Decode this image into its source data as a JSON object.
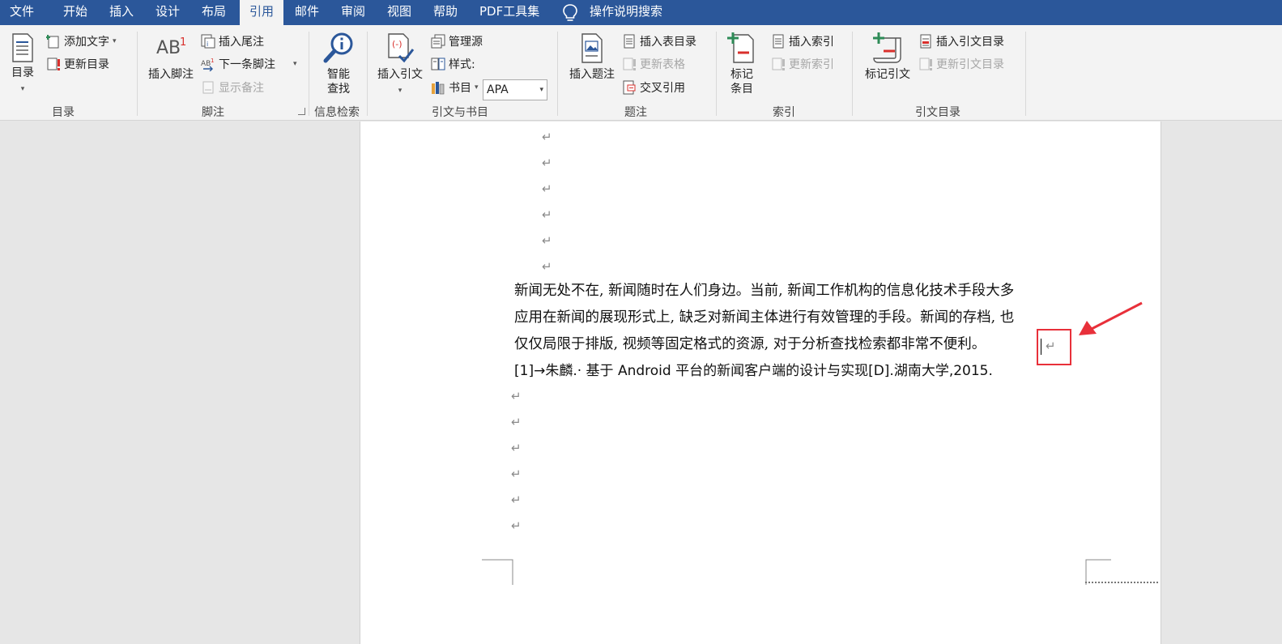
{
  "tabs": [
    "文件",
    "开始",
    "插入",
    "设计",
    "布局",
    "引用",
    "邮件",
    "审阅",
    "视图",
    "帮助",
    "PDF工具集"
  ],
  "active_tab": "引用",
  "search": {
    "label": "操作说明搜索"
  },
  "ribbon": {
    "toc": {
      "group": "目录",
      "big": "目录",
      "add_text": "添加文字",
      "update": "更新目录"
    },
    "footnotes": {
      "group": "脚注",
      "insert_footnote": "插入脚注",
      "insert_endnote": "插入尾注",
      "next_footnote": "下一条脚注",
      "show_notes": "显示备注",
      "ab_glyph": "AB",
      "sup": "1"
    },
    "research": {
      "group": "信息检索",
      "smart_lookup_line1": "智能",
      "smart_lookup_line2": "查找"
    },
    "citations": {
      "group": "引文与书目",
      "insert_citation": "插入引文",
      "manage_sources": "管理源",
      "style_label": "样式:",
      "style_value": "APA",
      "bibliography": "书目"
    },
    "captions": {
      "group": "题注",
      "insert_caption": "插入题注",
      "insert_table_of_figures": "插入表目录",
      "update_table": "更新表格",
      "cross_reference": "交叉引用"
    },
    "index": {
      "group": "索引",
      "mark_entry_line1": "标记",
      "mark_entry_line2": "条目",
      "insert_index": "插入索引",
      "update_index": "更新索引"
    },
    "toa": {
      "group": "引文目录",
      "mark_citation": "标记引文",
      "insert_toa": "插入引文目录",
      "update_toa": "更新引文目录"
    }
  },
  "document": {
    "para_mark": "↵",
    "body_lines": [
      "新闻无处不在, 新闻随时在人们身边。当前, 新闻工作机构的信息化技术手段大多",
      "应用在新闻的展现形式上, 缺乏对新闻主体进行有效管理的手段。新闻的存档, 也",
      "仅仅局限于排版, 视频等固定格式的资源, 对于分析查找检索都非常不便利。"
    ],
    "reference": "[1]→朱麟.· 基于 Android 平台的新闻客户端的设计与实现[D].湖南大学,2015."
  },
  "colors": {
    "tabbar": "#2b579a",
    "ribbon": "#f3f3f3",
    "highlight": "#e8303a"
  }
}
